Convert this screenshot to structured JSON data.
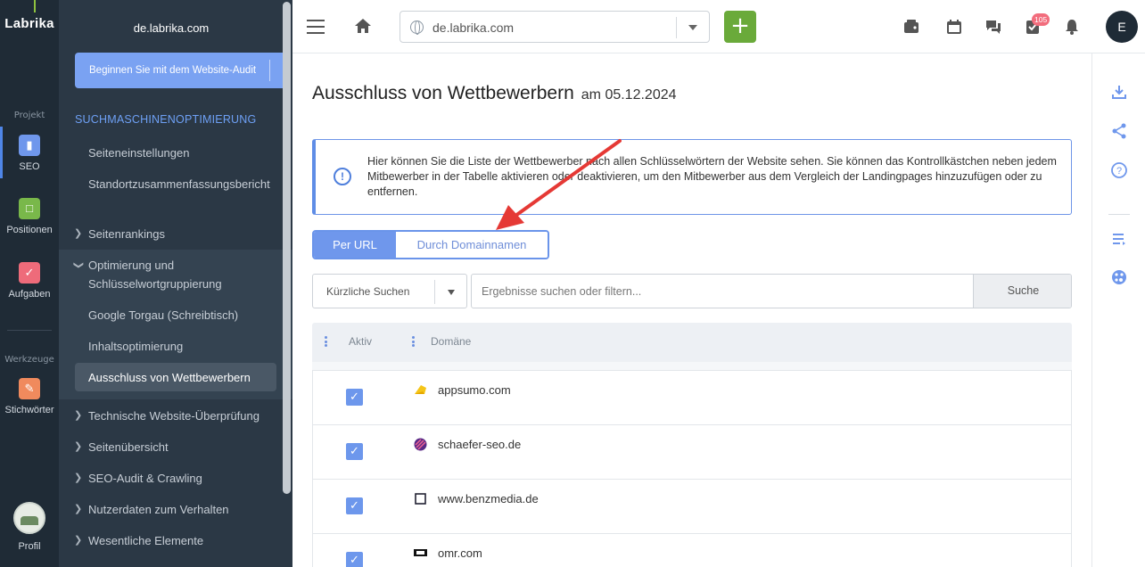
{
  "rail": {
    "logo": "Labrika",
    "caption_project": "Projekt",
    "caption_tools": "Werkzeuge",
    "items": [
      {
        "label": "SEO",
        "icon": "clipboard-icon",
        "color": "#6f97ec"
      },
      {
        "label": "Positionen",
        "icon": "chart-icon",
        "color": "#79b84a"
      },
      {
        "label": "Aufgaben",
        "icon": "check-icon",
        "color": "#ee6b7a"
      },
      {
        "label": "Stichwörter",
        "icon": "key-icon",
        "color": "#f08a5d"
      },
      {
        "label": "Profil",
        "icon": "avatar"
      }
    ]
  },
  "sidebar": {
    "domain": "de.labrika.com",
    "audit_button": "Beginnen Sie mit dem Website-Audit",
    "section_title": "SUCHMASCHINENOPTIMIERUNG",
    "items": [
      {
        "label": "Seiteneinstellungen"
      },
      {
        "label": "Standortzusammenfassungsbericht"
      },
      {
        "label": "Seitenrankings"
      },
      {
        "label": "Optimierung und Schlüsselwortgruppierung"
      },
      {
        "label": "Google Torgau (Schreibtisch)"
      },
      {
        "label": "Inhaltsoptimierung"
      },
      {
        "label": "Ausschluss von Wettbewerbern"
      },
      {
        "label": "Technische Website-Überprüfung"
      },
      {
        "label": "Seitenübersicht"
      },
      {
        "label": "SEO-Audit & Crawling"
      },
      {
        "label": "Nutzerdaten zum Verhalten"
      },
      {
        "label": "Wesentliche Elemente"
      }
    ]
  },
  "topbar": {
    "url": "de.labrika.com",
    "add_label": "+",
    "badge_count": "105",
    "user_initial": "E"
  },
  "main": {
    "title": "Ausschluss von Wettbewerbern",
    "date": "am 05.12.2024",
    "info_text": "Hier können Sie die Liste der Wettbewerber nach allen Schlüsselwörtern der Website sehen. Sie können das Kontrollkästchen neben jedem Mitbewerber in der Tabelle aktivieren oder deaktivieren, um den Mitbewerber aus dem Vergleich der Landingpages hinzuzufügen oder zu entfernen.",
    "toggle": {
      "option_a": "Per URL",
      "option_b": "Durch Domainnamen",
      "selected": "Per URL"
    },
    "recent_select": "Kürzliche Suchen",
    "search_placeholder": "Ergebnisse suchen oder filtern...",
    "search_button": "Suche",
    "columns": [
      "Aktiv",
      "Domäne"
    ],
    "rows": [
      {
        "checked": true,
        "domain": "appsumo.com",
        "favicon": "appsumo-favicon"
      },
      {
        "checked": true,
        "domain": "schaefer-seo.de",
        "favicon": "schaefer-favicon"
      },
      {
        "checked": true,
        "domain": "www.benzmedia.de",
        "favicon": "square-favicon"
      },
      {
        "checked": true,
        "domain": "omr.com",
        "favicon": "omr-favicon"
      }
    ]
  },
  "colors": {
    "accent": "#6f97ec",
    "sidebar_bg": "#2b3845",
    "rail_bg": "#1f2b36",
    "add_green": "#6aaa3a",
    "annotation_red": "#e53935"
  }
}
